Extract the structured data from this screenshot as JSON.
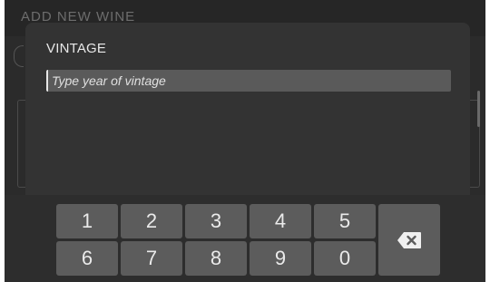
{
  "background": {
    "header_title": "ADD NEW WINE"
  },
  "dialog": {
    "title": "VINTAGE",
    "input": {
      "value": "",
      "placeholder": "Type year of vintage"
    }
  },
  "keyboard": {
    "row1": [
      "1",
      "2",
      "3",
      "4",
      "5"
    ],
    "row2": [
      "6",
      "7",
      "8",
      "9",
      "0"
    ],
    "backspace_icon": "backspace-icon"
  },
  "colors": {
    "screen_bg": "#2b2b2b",
    "dialog_bg": "#333333",
    "key_bg": "#5c5c5c",
    "input_bg": "#5a5a5a",
    "text": "#e8e8e8"
  }
}
